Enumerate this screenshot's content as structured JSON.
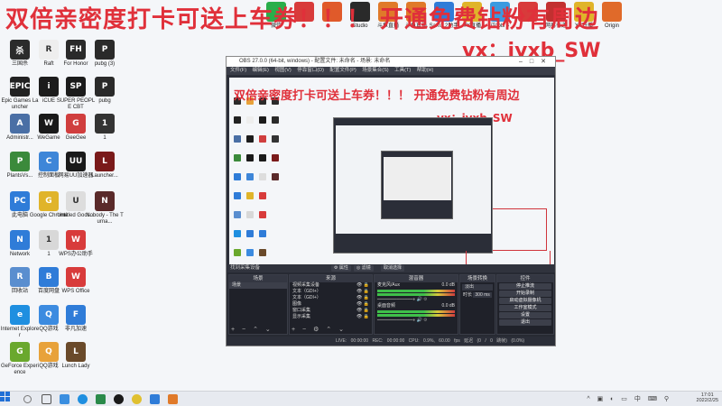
{
  "overlay": {
    "line1": "双倍亲密度打卡可送上车券！！！  开通免费钻粉有周边",
    "line2": "vx：jyxb_SW"
  },
  "desktop_icons": [
    {
      "label": "三国杀",
      "color": "#2b2b2b",
      "glyph": "杀"
    },
    {
      "label": "Epic Games Launcher",
      "color": "#222222",
      "glyph": "EPIC"
    },
    {
      "label": "Administr...",
      "color": "#4a6fa5",
      "glyph": "A"
    },
    {
      "label": "PlantsVs...",
      "color": "#3b8a3b",
      "glyph": "P"
    },
    {
      "label": "此电脑",
      "color": "#2f7cd8",
      "glyph": "PC"
    },
    {
      "label": "Network",
      "color": "#2f7cd8",
      "glyph": "N"
    },
    {
      "label": "回收站",
      "color": "#5a8ecf",
      "glyph": "R"
    },
    {
      "label": "Internet Explorer",
      "color": "#1f8fe0",
      "glyph": "e"
    },
    {
      "label": "GeForce Experience",
      "color": "#6aa82d",
      "glyph": "G"
    },
    {
      "label": "QQ游戏",
      "color": "#e8a23a",
      "glyph": "Q"
    },
    {
      "label": "Raft",
      "color": "#eeeeee",
      "glyph": "R"
    },
    {
      "label": "iCUE",
      "color": "#1c1c1c",
      "glyph": "i"
    },
    {
      "label": "WeGame",
      "color": "#1a1a1a",
      "glyph": "W"
    },
    {
      "label": "控制面板",
      "color": "#3e86d8",
      "glyph": "C"
    },
    {
      "label": "Google Chrome",
      "color": "#e0b42a",
      "glyph": "G"
    },
    {
      "label": "1",
      "color": "#d8d8d8",
      "glyph": "1"
    },
    {
      "label": "百度网盘",
      "color": "#2f7cd8",
      "glyph": "B"
    },
    {
      "label": "QQ游戏",
      "color": "#3c8be0",
      "glyph": "Q"
    },
    {
      "label": "For Honor",
      "color": "#2a2a2a",
      "glyph": "FH"
    },
    {
      "label": "SUPER PEOPLE CBT",
      "color": "#1b1b1b",
      "glyph": "SP"
    },
    {
      "label": "GeeGee",
      "color": "#d03e3e",
      "glyph": "G"
    },
    {
      "label": "网易UU加速器",
      "color": "#1a1a1a",
      "glyph": "UU"
    },
    {
      "label": "Untitled Goos...",
      "color": "#dddddd",
      "glyph": "U"
    },
    {
      "label": "WPS办公助手",
      "color": "#d83b3b",
      "glyph": "W"
    },
    {
      "label": "WPS Office",
      "color": "#d83b3b",
      "glyph": "W"
    },
    {
      "label": "非凡加速",
      "color": "#2f7cd8",
      "glyph": "F"
    },
    {
      "label": "Lunch Lady",
      "color": "#6a4a2a",
      "glyph": "L"
    },
    {
      "label": "pubg (3)",
      "color": "#2a2a2a",
      "glyph": "P"
    },
    {
      "label": "pubg",
      "color": "#2a2a2a",
      "glyph": "P"
    },
    {
      "label": "1",
      "color": "#333333",
      "glyph": "1"
    },
    {
      "label": "Launcher...",
      "color": "#7a1a1a",
      "glyph": "L"
    },
    {
      "label": "Nobody - The Turna...",
      "color": "#5a2a2a",
      "glyph": "N"
    }
  ],
  "top_icons": [
    {
      "label": "微信",
      "color": "#2aae4a"
    },
    {
      "label": "",
      "color": "#d83b3b"
    },
    {
      "label": "",
      "color": "#e05a2a"
    },
    {
      "label": "Studio",
      "color": "#2a2a2a"
    },
    {
      "label": "斗鱼直播",
      "color": "#e07a2a"
    },
    {
      "label": "斗鱼直播",
      "color": "#e07a2a"
    },
    {
      "label": "Sam1.2助手",
      "color": "#2f7cd8"
    },
    {
      "label": "YY直播",
      "color": "#e0b42a"
    },
    {
      "label": "iTools 4",
      "color": "#3a9ae0"
    },
    {
      "label": "",
      "color": "#d83b3b"
    },
    {
      "label": "网易有道",
      "color": "#c23030"
    },
    {
      "label": "YY开播",
      "color": "#e0b42a"
    },
    {
      "label": "Origin",
      "color": "#e06a2a"
    }
  ],
  "obs": {
    "title": "OBS 27.0.0 (64-bit, windows) - 配置文件: 未命名 - 场景: 未命名",
    "menu": "文件(F) 编辑(E) 视图(V) 停靠窗口(D) 配置文件(P) 场景集合(S) 工具(T) 帮助(H)",
    "scene_header": "找到采集设备",
    "props_label": "属性",
    "filter_label": "滤镜",
    "cancel_label": "取消选择",
    "panels": {
      "scenes": "场景",
      "sources": "来源",
      "mixer": "混音器",
      "transitions": "场景转换",
      "controls": "控件"
    },
    "scene_items": [
      "场景"
    ],
    "source_items": [
      "视频采集设备",
      "文本（GDI+）",
      "文本（GDI+）",
      "图像",
      "窗口采集",
      "显示采集"
    ],
    "mixer_items": [
      "麦克风/Aux",
      "桌面音频"
    ],
    "mixer_db": [
      "0.0 dB",
      "0.0 dB"
    ],
    "transition": {
      "type": "淡出",
      "duration_label": "时长",
      "duration": "300 ms"
    },
    "controls": [
      "停止推流",
      "开始录制",
      "启动虚拟摄像机",
      "工作室模式",
      "设置",
      "退出"
    ],
    "status": "LIVE: 00:00:00   REC: 00:00:00   CPU: 0.9%, 60.00 fps   延迟 (0 / 0 跳帧) (0.0%)"
  },
  "taskbar": {
    "time": "17:01",
    "date": "2022/2/25",
    "ime": "中"
  }
}
